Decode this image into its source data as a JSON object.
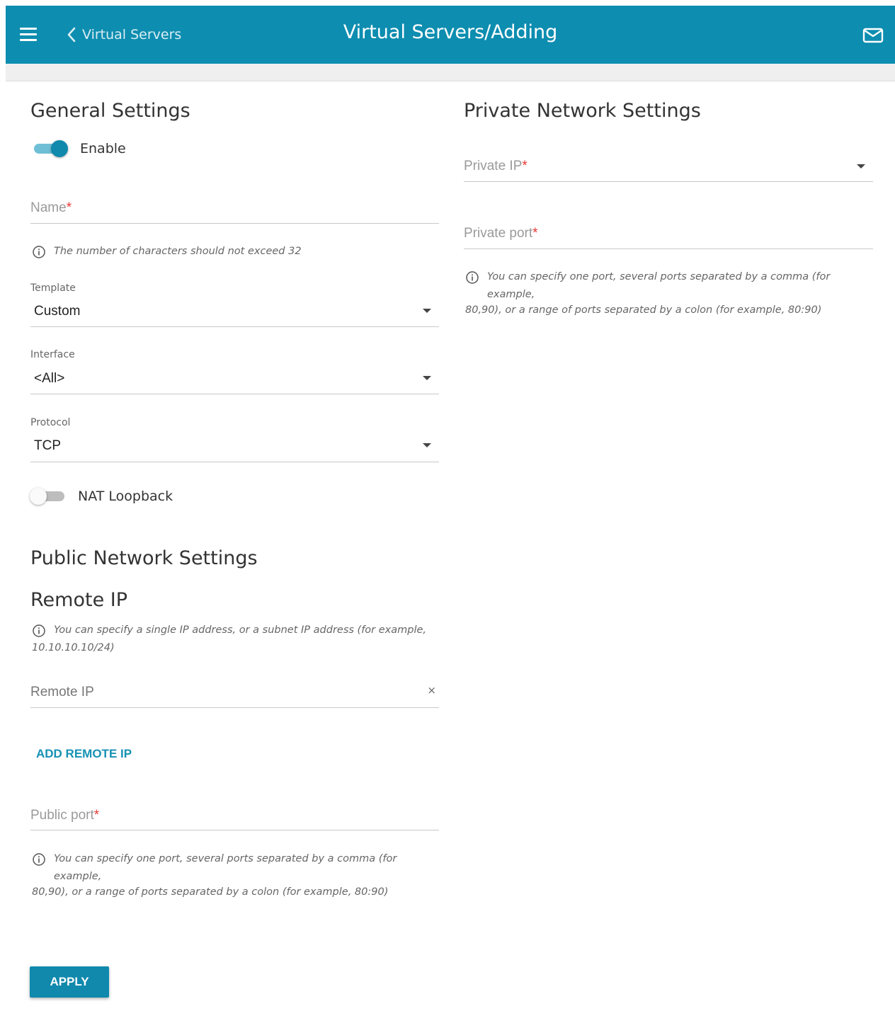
{
  "header": {
    "back_label": "Virtual Servers",
    "title": "Virtual Servers/Adding",
    "menu_icon": "hamburger-icon",
    "mail_icon": "mail-icon",
    "accent": "#0d8db0"
  },
  "general": {
    "title": "General Settings",
    "enable_label": "Enable",
    "enable_on": true,
    "name": {
      "placeholder": "Name",
      "required_mark": "*",
      "value": ""
    },
    "name_hint": "The number of characters should not exceed 32",
    "template": {
      "label": "Template",
      "value": "Custom"
    },
    "interface": {
      "label": "Interface",
      "value": "<All>"
    },
    "protocol": {
      "label": "Protocol",
      "value": "TCP"
    },
    "nat_loopback_label": "NAT Loopback",
    "nat_loopback_on": false
  },
  "public": {
    "title": "Public Network Settings",
    "remote_ip_title": "Remote IP",
    "remote_ip_hint_line1": "You can specify a single IP address, or a subnet IP address (for example,",
    "remote_ip_hint_line2": "10.10.10.10/24)",
    "remote_ip": {
      "placeholder": "Remote IP",
      "value": "",
      "clear": "×"
    },
    "add_remote_ip": "ADD REMOTE IP",
    "public_port": {
      "placeholder": "Public port",
      "required_mark": "*",
      "value": ""
    },
    "port_hint_line1": "You can specify one port, several ports separated by a comma (for example,",
    "port_hint_line2": "80,90), or a range of ports separated by a colon (for example, 80:90)"
  },
  "private": {
    "title": "Private Network Settings",
    "private_ip": {
      "placeholder": "Private IP",
      "required_mark": "*",
      "value": ""
    },
    "private_port": {
      "placeholder": "Private port",
      "required_mark": "*",
      "value": ""
    },
    "port_hint_line1": "You can specify one port, several ports separated by a comma (for example,",
    "port_hint_line2": "80,90), or a range of ports separated by a colon (for example, 80:90)"
  },
  "apply_label": "APPLY"
}
